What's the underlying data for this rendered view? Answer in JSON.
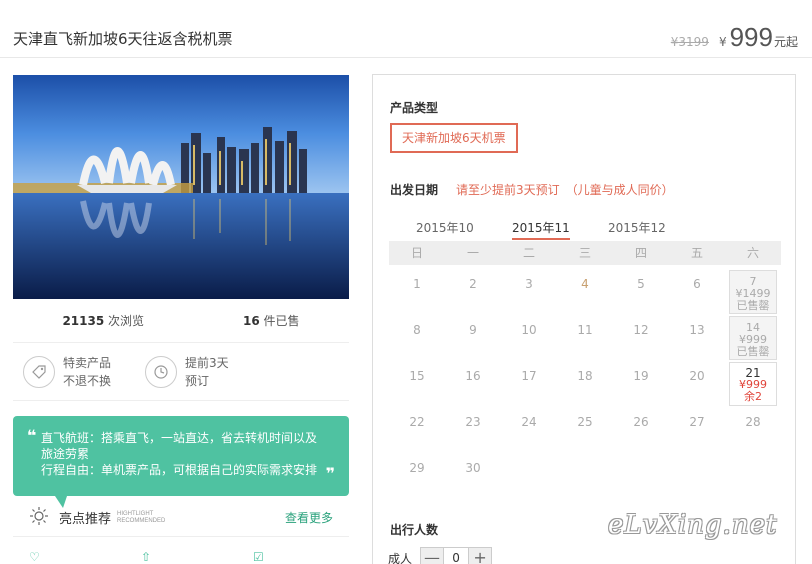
{
  "title_bar": {
    "product_title": "天津直飞新加坡6天往返含税机票",
    "original_price": "¥3199",
    "currency_symbol": "¥",
    "current_price": "999",
    "price_suffix": "元起"
  },
  "stats": {
    "views_count": "21135",
    "views_label": "次浏览",
    "sold_count": "16",
    "sold_label": "件已售"
  },
  "features": [
    {
      "icon": "tag-icon",
      "line1": "特卖产品",
      "line2": "不退不换"
    },
    {
      "icon": "clock-history-icon",
      "line1": "提前3天",
      "line2": "预订"
    }
  ],
  "highlight": {
    "open_quote": "❝",
    "line1": "直飞航班：搭乘直飞，一站直达，省去转机时间以及",
    "line2": "旅途劳累",
    "line3": "行程自由：单机票产品，可根据自己的实际需求安排",
    "close_quote": "❞"
  },
  "highlight_row": {
    "title": "亮点推荐",
    "en_line1": "HIGHTLIGHT",
    "en_line2": "RECOMMENDED",
    "more": "查看更多"
  },
  "booking": {
    "product_type_label": "产品类型",
    "product_type_option": "天津新加坡6天机票",
    "date_label": "出发日期",
    "date_tip": "请至少提前3天预订　（儿童与成人同价）",
    "months": [
      "2015年10",
      "2015年11",
      "2015年12"
    ],
    "active_month": "2015年11",
    "weekdays": [
      "日",
      "一",
      "二",
      "三",
      "四",
      "五",
      "六"
    ],
    "traveler_label": "出行人数",
    "adult_label": "成人",
    "adult_count": "0",
    "minus": "—",
    "plus": "+"
  },
  "calendar": {
    "weeks": [
      [
        {
          "d": "1"
        },
        {
          "d": "2"
        },
        {
          "d": "3"
        },
        {
          "d": "4",
          "style": "orange"
        },
        {
          "d": "5"
        },
        {
          "d": "6"
        },
        {
          "d": "7",
          "price": "¥1499",
          "status": "已售罄",
          "state": "soldout"
        }
      ],
      [
        {
          "d": "8"
        },
        {
          "d": "9"
        },
        {
          "d": "10"
        },
        {
          "d": "11"
        },
        {
          "d": "12"
        },
        {
          "d": "13"
        },
        {
          "d": "14",
          "price": "¥999",
          "status": "已售罄",
          "state": "soldout"
        }
      ],
      [
        {
          "d": "15"
        },
        {
          "d": "16"
        },
        {
          "d": "17"
        },
        {
          "d": "18"
        },
        {
          "d": "19"
        },
        {
          "d": "20"
        },
        {
          "d": "21",
          "price": "¥999",
          "status": "余2",
          "state": "avail"
        }
      ],
      [
        {
          "d": "22"
        },
        {
          "d": "23"
        },
        {
          "d": "24"
        },
        {
          "d": "25"
        },
        {
          "d": "26"
        },
        {
          "d": "27"
        },
        {
          "d": "28"
        }
      ],
      [
        {
          "d": "29"
        },
        {
          "d": "30"
        }
      ]
    ]
  },
  "watermark": "eLvXing.net"
}
